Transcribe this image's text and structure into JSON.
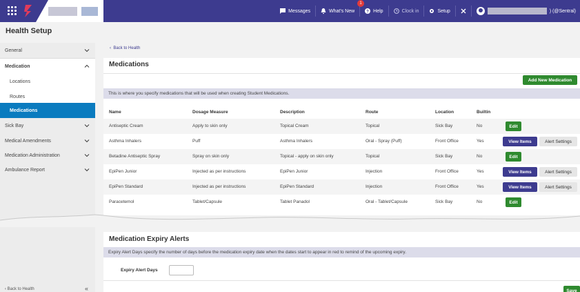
{
  "header": {
    "title": "Health Setup",
    "nav": {
      "messages": "Messages",
      "whats_new": "What's New",
      "whats_new_badge": "1",
      "help": "Help",
      "clock_in": "Clock in",
      "setup": "Setup",
      "user_suffix": ") (@Sentral)"
    }
  },
  "sidebar": {
    "general": "General",
    "medication": "Medication",
    "locations": "Locations",
    "routes": "Routes",
    "medications": "Medications",
    "sick_bay": "Sick Bay",
    "medical_amendments": "Medical Amendments",
    "medication_administration": "Medication Administration",
    "ambulance_report": "Ambulance Report",
    "back": "Back to Health",
    "collapse": "«"
  },
  "main": {
    "back_link": "Back to Health",
    "title": "Medications",
    "add_button": "Add New Medication",
    "info": "This is where you specify medications that will be used when creating Student Medications.",
    "columns": [
      "Name",
      "Dosage Measure",
      "Description",
      "Route",
      "Location",
      "Builtin"
    ],
    "rows": [
      {
        "name": "Antiseptic Cream",
        "dosage": "Apply to skin only",
        "description": "Topical Cream",
        "route": "Topical",
        "location": "Sick Bay",
        "builtin": "No"
      },
      {
        "name": "Asthma Inhalers",
        "dosage": "Puff",
        "description": "Asthma Inhalers",
        "route": "Oral - Spray (Puff)",
        "location": "Front Office",
        "builtin": "Yes"
      },
      {
        "name": "Betadine Antiseptic Spray",
        "dosage": "Spray on skin only",
        "description": "Topical - apply on skin only",
        "route": "Topical",
        "location": "Sick Bay",
        "builtin": "No"
      },
      {
        "name": "EpiPen Junior",
        "dosage": "Injected as per instructions",
        "description": "EpiPen Junior",
        "route": "Injection",
        "location": "Front Office",
        "builtin": "Yes"
      },
      {
        "name": "EpiPen Standard",
        "dosage": "Injected as per instructions",
        "description": "EpiPen Standard",
        "route": "Injection",
        "location": "Front Office",
        "builtin": "Yes"
      },
      {
        "name": "Paracetemol",
        "dosage": "Tablet/Capsule",
        "description": "Tablet Panadol",
        "route": "Oral - Tablet/Capsule",
        "location": "Sick Bay",
        "builtin": "No"
      }
    ],
    "edit_label": "Edit",
    "view_items_label": "View Items",
    "alert_settings_label": "Alert Settings"
  },
  "expiry": {
    "title": "Medication Expiry Alerts",
    "info": "Expiry Alert Days specify the number of days before the medication expiry date when the dates start to appear in red to remind of the upcoming expiry.",
    "label": "Expiry Alert Days",
    "value": "",
    "save_label": "Save"
  },
  "colors": {
    "topbar": "#3d3b8f",
    "active": "#0a7bbf",
    "green": "#2f8a2f",
    "info_bar": "#dcdcea"
  }
}
